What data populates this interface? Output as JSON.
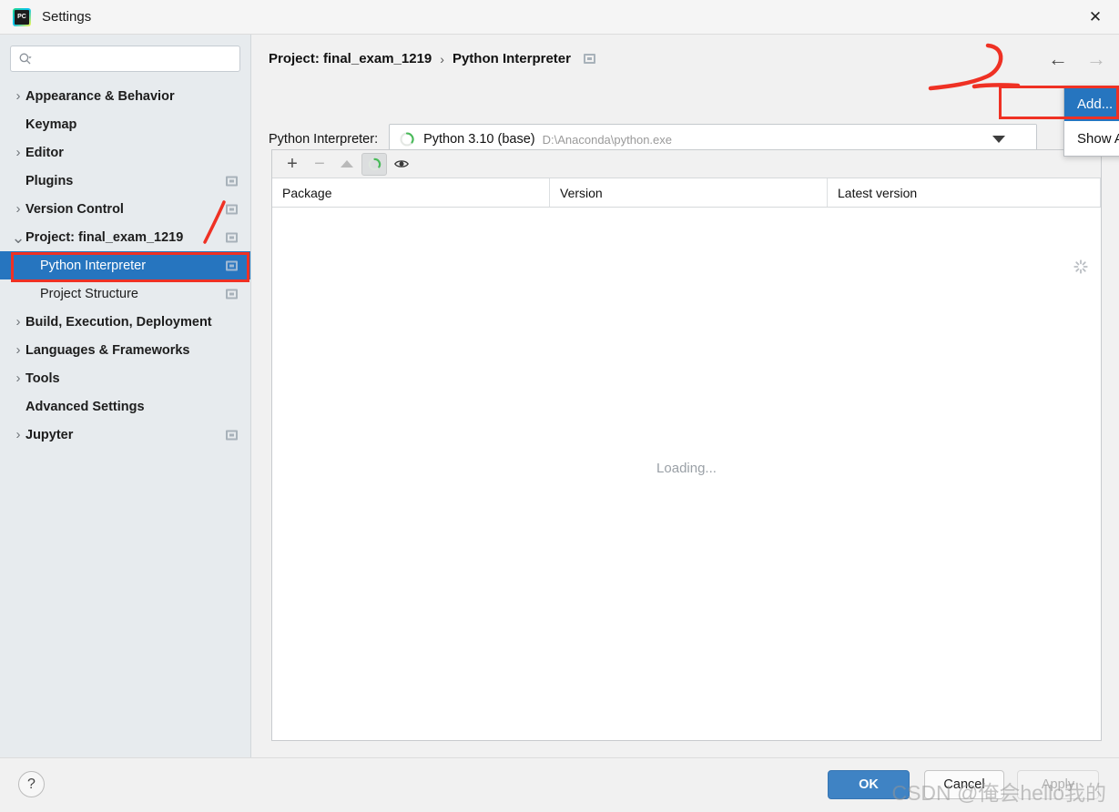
{
  "window": {
    "title": "Settings",
    "app_icon": "pycharm-logo-icon",
    "close_icon": "close-icon"
  },
  "sidebar": {
    "search": {
      "placeholder": "",
      "value": "",
      "icon": "search-icon"
    },
    "items": [
      {
        "label": "Appearance & Behavior",
        "expandable": true,
        "expanded": false,
        "bold": true,
        "child": false,
        "scope": false
      },
      {
        "label": "Keymap",
        "expandable": false,
        "expanded": false,
        "bold": true,
        "child": false,
        "scope": false
      },
      {
        "label": "Editor",
        "expandable": true,
        "expanded": false,
        "bold": true,
        "child": false,
        "scope": false
      },
      {
        "label": "Plugins",
        "expandable": false,
        "expanded": false,
        "bold": true,
        "child": false,
        "scope": true
      },
      {
        "label": "Version Control",
        "expandable": true,
        "expanded": false,
        "bold": true,
        "child": false,
        "scope": true
      },
      {
        "label": "Project: final_exam_1219",
        "expandable": true,
        "expanded": true,
        "bold": true,
        "child": false,
        "scope": true
      },
      {
        "label": "Python Interpreter",
        "expandable": false,
        "expanded": false,
        "bold": false,
        "child": true,
        "scope": true,
        "selected": true
      },
      {
        "label": "Project Structure",
        "expandable": false,
        "expanded": false,
        "bold": false,
        "child": true,
        "scope": true
      },
      {
        "label": "Build, Execution, Deployment",
        "expandable": true,
        "expanded": false,
        "bold": true,
        "child": false,
        "scope": false
      },
      {
        "label": "Languages & Frameworks",
        "expandable": true,
        "expanded": false,
        "bold": true,
        "child": false,
        "scope": false
      },
      {
        "label": "Tools",
        "expandable": true,
        "expanded": false,
        "bold": true,
        "child": false,
        "scope": false
      },
      {
        "label": "Advanced Settings",
        "expandable": false,
        "expanded": false,
        "bold": true,
        "child": false,
        "scope": false
      },
      {
        "label": "Jupyter",
        "expandable": true,
        "expanded": false,
        "bold": true,
        "child": false,
        "scope": true
      }
    ]
  },
  "content": {
    "breadcrumb": {
      "parent": "Project: final_exam_1219",
      "separator": "›",
      "current": "Python Interpreter"
    },
    "nav": {
      "back_icon": "arrow-left-icon",
      "forward_icon": "arrow-right-icon"
    },
    "interpreter": {
      "label": "Python Interpreter:",
      "icon": "python-loading-icon",
      "name": "Python 3.10 (base)",
      "path": "D:\\Anaconda\\python.exe",
      "dropdown_icon": "chevron-down-icon"
    },
    "interpreter_menu": {
      "items": [
        {
          "label": "Add...",
          "highlighted": true
        },
        {
          "label": "Show All...",
          "highlighted": false
        }
      ]
    },
    "packages": {
      "toolbar": [
        {
          "icon": "plus-icon",
          "name": "install-package-button",
          "state": "enabled"
        },
        {
          "icon": "minus-icon",
          "name": "uninstall-package-button",
          "state": "disabled"
        },
        {
          "icon": "arrow-up-icon",
          "name": "upgrade-package-button",
          "state": "disabled"
        },
        {
          "icon": "refresh-spinner-icon",
          "name": "refresh-button",
          "state": "active"
        },
        {
          "icon": "eye-icon",
          "name": "show-early-releases-button",
          "state": "enabled"
        }
      ],
      "columns": [
        "Package",
        "Version",
        "Latest version"
      ],
      "rows": [],
      "loading_text": "Loading...",
      "loading_spinner_icon": "loading-spinner-icon"
    }
  },
  "footer": {
    "help_icon": "help-question-icon",
    "ok": "OK",
    "cancel": "Cancel",
    "apply": "Apply"
  },
  "annotations": {
    "highlight_color": "#ef3124",
    "watermark": "CSDN @俺会hello我的"
  }
}
